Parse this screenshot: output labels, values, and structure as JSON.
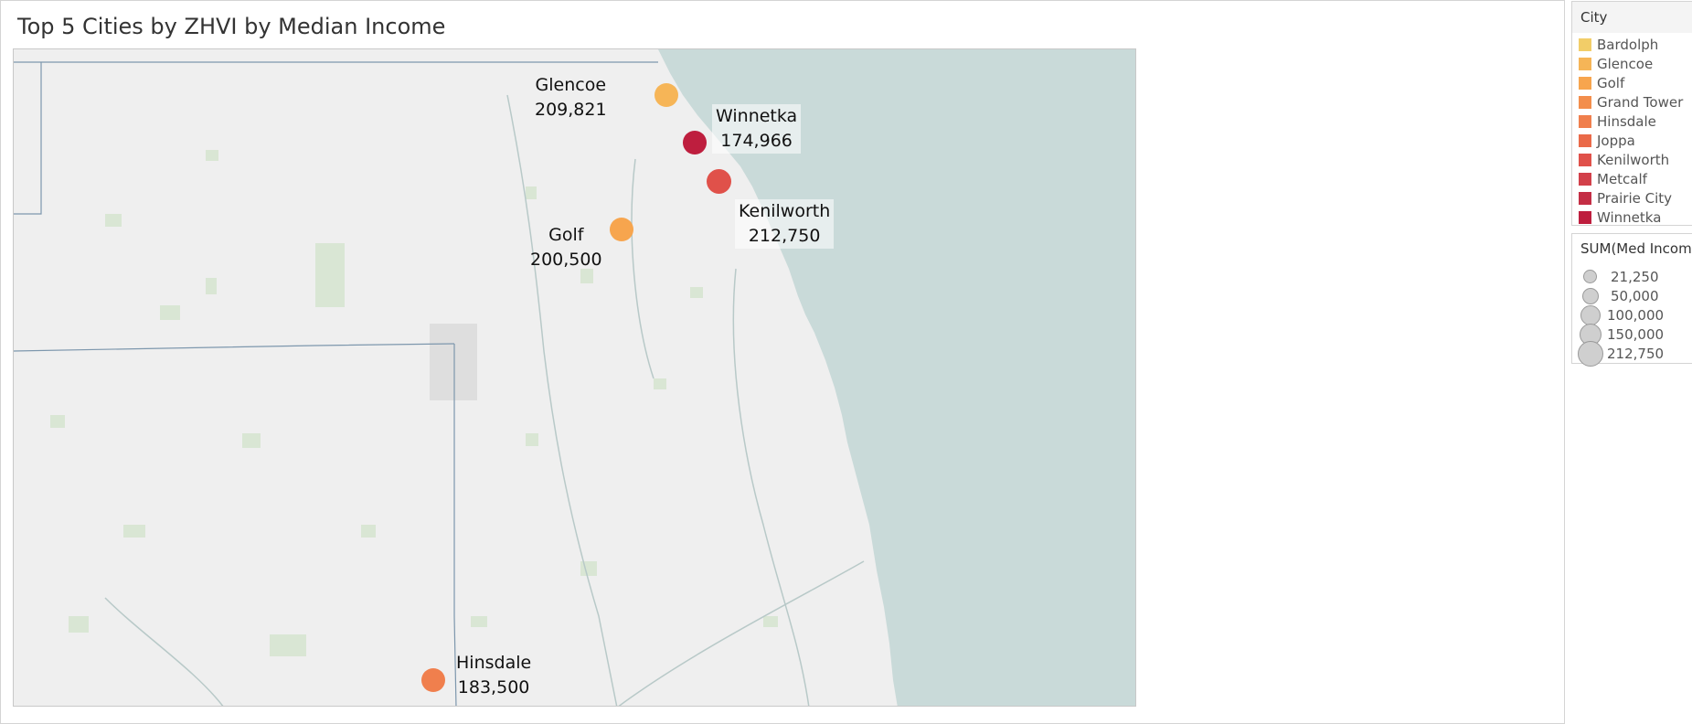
{
  "title": "Top 5 Cities by ZHVI by Median Income",
  "map": {
    "water_color": "#c9dad9",
    "land_color": "#efefef",
    "markers": [
      {
        "city": "Glencoe",
        "value_label": "209,821",
        "value": 209821,
        "color": "#f6b557"
      },
      {
        "city": "Winnetka",
        "value_label": "174,966",
        "value": 174966,
        "color": "#be1e3e"
      },
      {
        "city": "Kenilworth",
        "value_label": "212,750",
        "value": 212750,
        "color": "#e0514a"
      },
      {
        "city": "Golf",
        "value_label": "200,500",
        "value": 200500,
        "color": "#f7a54e"
      },
      {
        "city": "Hinsdale",
        "value_label": "183,500",
        "value": 183500,
        "color": "#f07f4d"
      }
    ]
  },
  "legend_city": {
    "title": "City",
    "items": [
      {
        "label": "Bardolph",
        "color": "#f2cd68"
      },
      {
        "label": "Glencoe",
        "color": "#f6b557"
      },
      {
        "label": "Golf",
        "color": "#f7a54e"
      },
      {
        "label": "Grand Tower",
        "color": "#f38e4c"
      },
      {
        "label": "Hinsdale",
        "color": "#f07f4d"
      },
      {
        "label": "Joppa",
        "color": "#ea6a49"
      },
      {
        "label": "Kenilworth",
        "color": "#e0514a"
      },
      {
        "label": "Metcalf",
        "color": "#d2404a"
      },
      {
        "label": "Prairie City",
        "color": "#c42e45"
      },
      {
        "label": "Winnetka",
        "color": "#be1e3e"
      }
    ]
  },
  "legend_size": {
    "title": "SUM(Med Income",
    "items": [
      {
        "label": "21,250",
        "value": 21250
      },
      {
        "label": "50,000",
        "value": 50000
      },
      {
        "label": "100,000",
        "value": 100000
      },
      {
        "label": "150,000",
        "value": 150000
      },
      {
        "label": "212,750",
        "value": 212750
      }
    ]
  }
}
